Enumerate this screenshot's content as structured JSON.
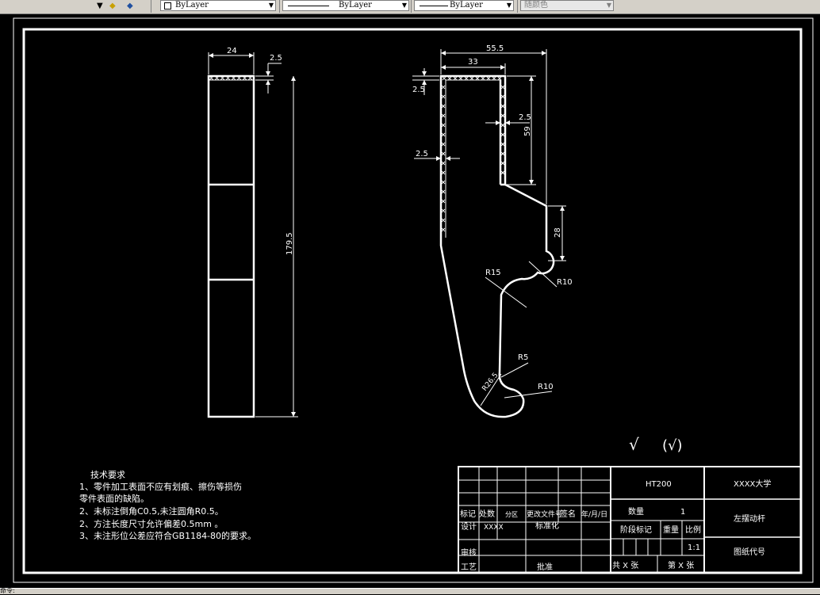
{
  "toolbar": {
    "layer_color_label": "ByLayer",
    "linetype_label": "ByLayer",
    "lineweight_label": "ByLayer",
    "plot_style_label": "随颜色"
  },
  "drawing": {
    "left_view": {
      "dim_width": "24",
      "dim_top": "2.5",
      "dim_height": "179.5"
    },
    "main_view": {
      "dim_total_width": "55.5",
      "dim_inner_width": "33",
      "dim_left_top": "2.5",
      "dim_left_mid": "2.5",
      "dim_inner_thick": "2.5",
      "dim_slot_depth": "59",
      "dim_flat": "28",
      "r15": "R15",
      "r10_upper": "R10",
      "r5": "R5",
      "r26": "R26.5",
      "r10_lower": "R10"
    },
    "roughness": {
      "mark": "√",
      "paren_mark": "(√)"
    },
    "tech_requirements": {
      "title": "技术要求",
      "line1a": "1、零件加工表面不应有划痕、擦伤等损伤",
      "line1b": "零件表面的缺陷。",
      "line2": "2、未标注倒角C0.5,未注圆角R0.5。",
      "line3": "2、方注长度尺寸允许偏差0.5mm 。",
      "line4": "3、未注形位公差应符合GB1184-80的要求。"
    },
    "title_block": {
      "material": "HT200",
      "school": "XXXX大学",
      "part_name": "左摆动杆",
      "drawing_no": "图纸代号",
      "qty_label": "数量",
      "qty_value": "1",
      "stage_label": "阶段标记",
      "weight_label": "重量",
      "scale_label": "比例",
      "scale_value": "1:1",
      "total_sheets": "共  X  张",
      "sheet_no": "第  X  张",
      "mark": "标记",
      "count": "处数",
      "zone": "分区",
      "change_doc": "更改文件号",
      "sign": "签名",
      "date": "年/月/日",
      "design": "设计",
      "designer": "XXXX",
      "standardize": "标准化",
      "review": "审核",
      "process": "工艺",
      "approve": "批准"
    }
  },
  "status": {
    "text": "命令:"
  }
}
